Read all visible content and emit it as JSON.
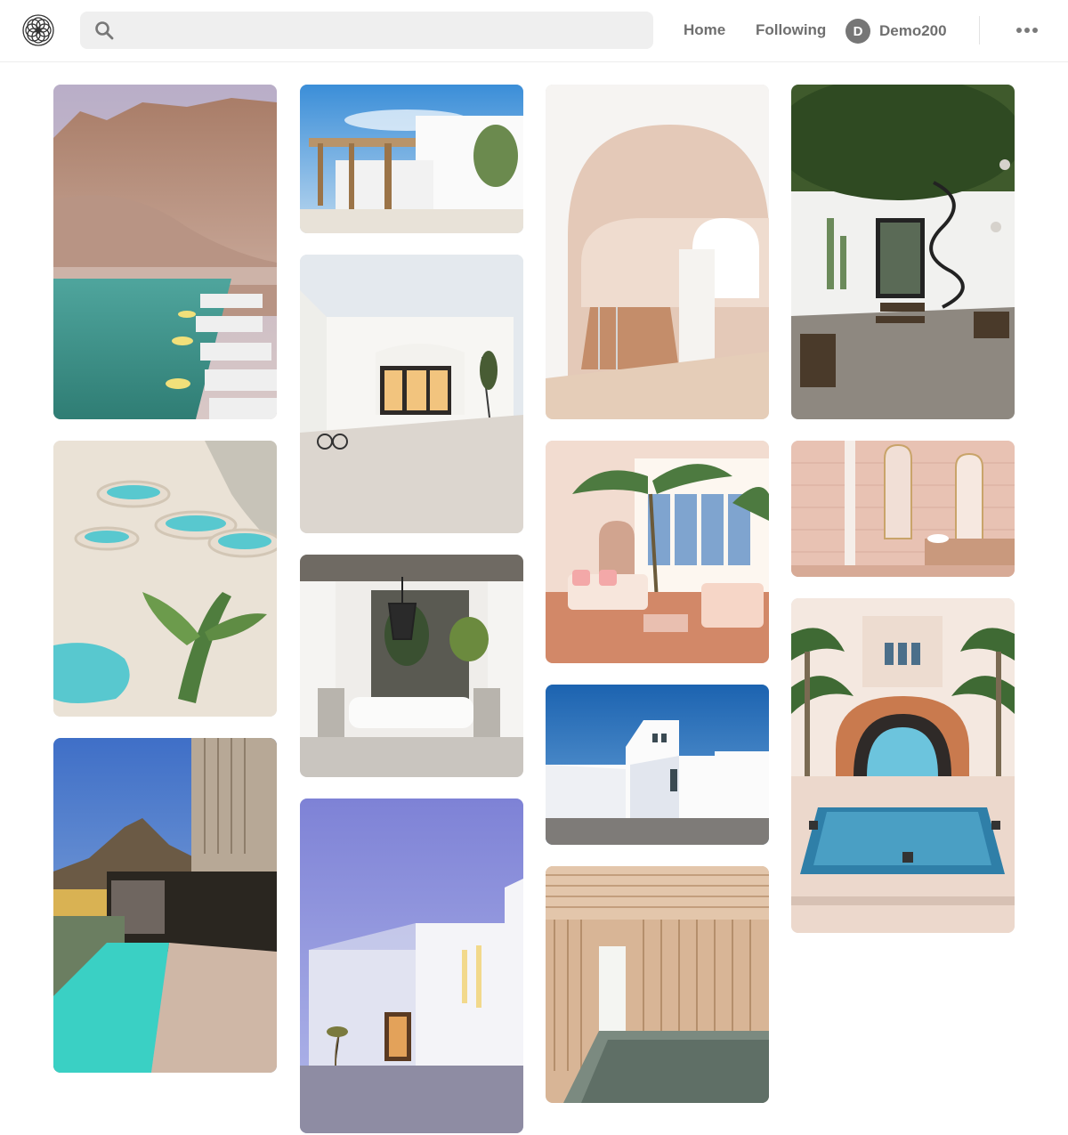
{
  "header": {
    "logo_icon": "geometric-flower-logo-icon",
    "search": {
      "placeholder": "",
      "value": "",
      "icon": "search-icon"
    },
    "nav": {
      "home_label": "Home",
      "following_label": "Following"
    },
    "user": {
      "avatar_initial": "D",
      "name": "Demo200"
    },
    "more_icon": "ellipsis-icon"
  },
  "colors": {
    "nav_text": "#6f6f6f",
    "search_bg": "#efefef",
    "avatar_bg": "#767676"
  },
  "pins": [
    {
      "id": "desert-canyon-pool",
      "subject": "canyon cliff with turquoise pool and white loungers"
    },
    {
      "id": "white-terrace-pergola",
      "subject": "white villa terrace with wooden pergola"
    },
    {
      "id": "arched-pink-interior",
      "subject": "pale pink interior with large arches"
    },
    {
      "id": "courtyard-spiral-stair",
      "subject": "white courtyard with spiral stair and cacti"
    },
    {
      "id": "white-villa-gravel",
      "subject": "white house with glass door and gravel courtyard"
    },
    {
      "id": "travertine-pools",
      "subject": "white travertine terraces with turquoise pools"
    },
    {
      "id": "pink-living-palms",
      "subject": "pink living room with palms and arched windows"
    },
    {
      "id": "pink-tile-bathroom",
      "subject": "pink tiled bathroom with arched mirrors"
    },
    {
      "id": "white-lounge-pendant",
      "subject": "white lounge with black pendant lamp"
    },
    {
      "id": "cycladic-white-houses",
      "subject": "white cubic houses under blue sky"
    },
    {
      "id": "moorish-pool-palms",
      "subject": "moorish arch with pool and palm trees"
    },
    {
      "id": "mountain-lap-pool",
      "subject": "modern house with lap pool and mountain"
    },
    {
      "id": "wood-indoor-pool",
      "subject": "timber clad indoor pool"
    },
    {
      "id": "white-house-twilight",
      "subject": "white house at twilight"
    }
  ]
}
